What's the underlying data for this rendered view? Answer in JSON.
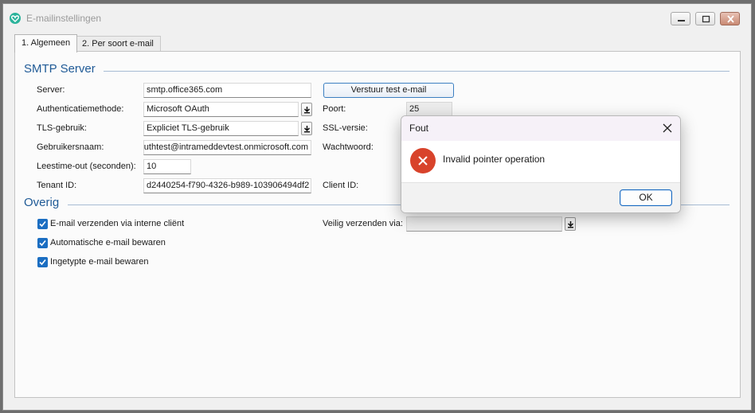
{
  "window": {
    "title": "E-mailinstellingen"
  },
  "tabs": [
    {
      "label": "1. Algemeen"
    },
    {
      "label": "2. Per soort e-mail"
    }
  ],
  "smtp": {
    "group_title": "SMTP Server",
    "server_label": "Server:",
    "server_value": "smtp.office365.com",
    "test_button": "Verstuur test e-mail",
    "auth_label": "Authenticatiemethode:",
    "auth_value": "Microsoft OAuth",
    "port_label": "Poort:",
    "port_value": "25",
    "tls_label": "TLS-gebruik:",
    "tls_value": "Expliciet TLS-gebruik",
    "ssl_label": "SSL-versie:",
    "user_label": "Gebruikersnaam:",
    "user_value": "uthtest@intrameddevtest.onmicrosoft.com",
    "password_label": "Wachtwoord:",
    "timeout_label": "Leestime-out (seconden):",
    "timeout_value": "10",
    "tenant_label": "Tenant ID:",
    "tenant_value": "d2440254-f790-4326-b989-103906494df2",
    "client_label": "Client ID:"
  },
  "overig": {
    "group_title": "Overig",
    "cb_internal": "E-mail verzenden via interne cliënt",
    "cb_autosave": "Automatische e-mail bewaren",
    "cb_typed": "Ingetypte e-mail bewaren",
    "secure_label": "Veilig verzenden via:"
  },
  "dialog": {
    "title": "Fout",
    "message": "Invalid pointer operation",
    "ok": "OK"
  },
  "colors": {
    "accent": "#1b6ec2",
    "group_title": "#1f5a96",
    "error": "#d8432b"
  },
  "icons": {
    "app": "heart-icon",
    "error": "error-x-icon",
    "dropdown": "dropdown-arrow-icon"
  }
}
